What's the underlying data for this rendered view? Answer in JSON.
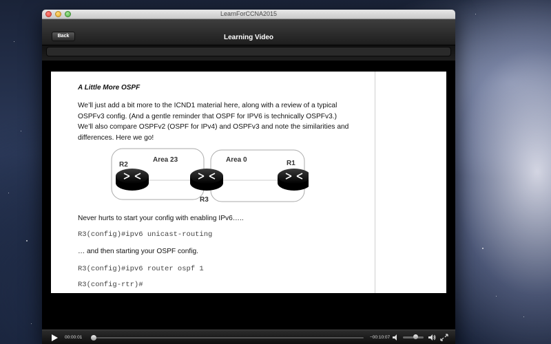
{
  "window": {
    "title": "LearnForCCNA2015"
  },
  "header": {
    "back_label": "Back",
    "title": "Learning Video"
  },
  "slide": {
    "title": "A Little More OSPF",
    "paragraph": "We’ll just add a bit more to the ICND1 material here, along with a review of a typical OSPFv3 config.   (And a gentle reminder that OSPF for IPV6 is technically OSPFv3.)  We’ll also compare OSPFv2 (OSPF for IPv4) and OSPFv3 and note the similarities and differences.  Here we go!",
    "diagram": {
      "area_left": "Area 23",
      "area_right": "Area 0",
      "router_left": "R2",
      "router_center": "R3",
      "router_right": "R1"
    },
    "line1": "Never hurts to start your config with enabling IPv6…..",
    "code1": "R3(config)#ipv6 unicast-routing",
    "line2": "… and then starting your OSPF config.",
    "code2": "R3(config)#ipv6 router ospf 1",
    "code3": "R3(config-rtr)#"
  },
  "controls": {
    "elapsed": "00:00:01",
    "remaining": "−00:10:07",
    "progress_fraction": 0.002,
    "volume_fraction": 0.6,
    "icons": [
      "play-icon",
      "rewind-icon",
      "volume-low-icon",
      "volume-high-icon",
      "fullscreen-icon"
    ]
  }
}
